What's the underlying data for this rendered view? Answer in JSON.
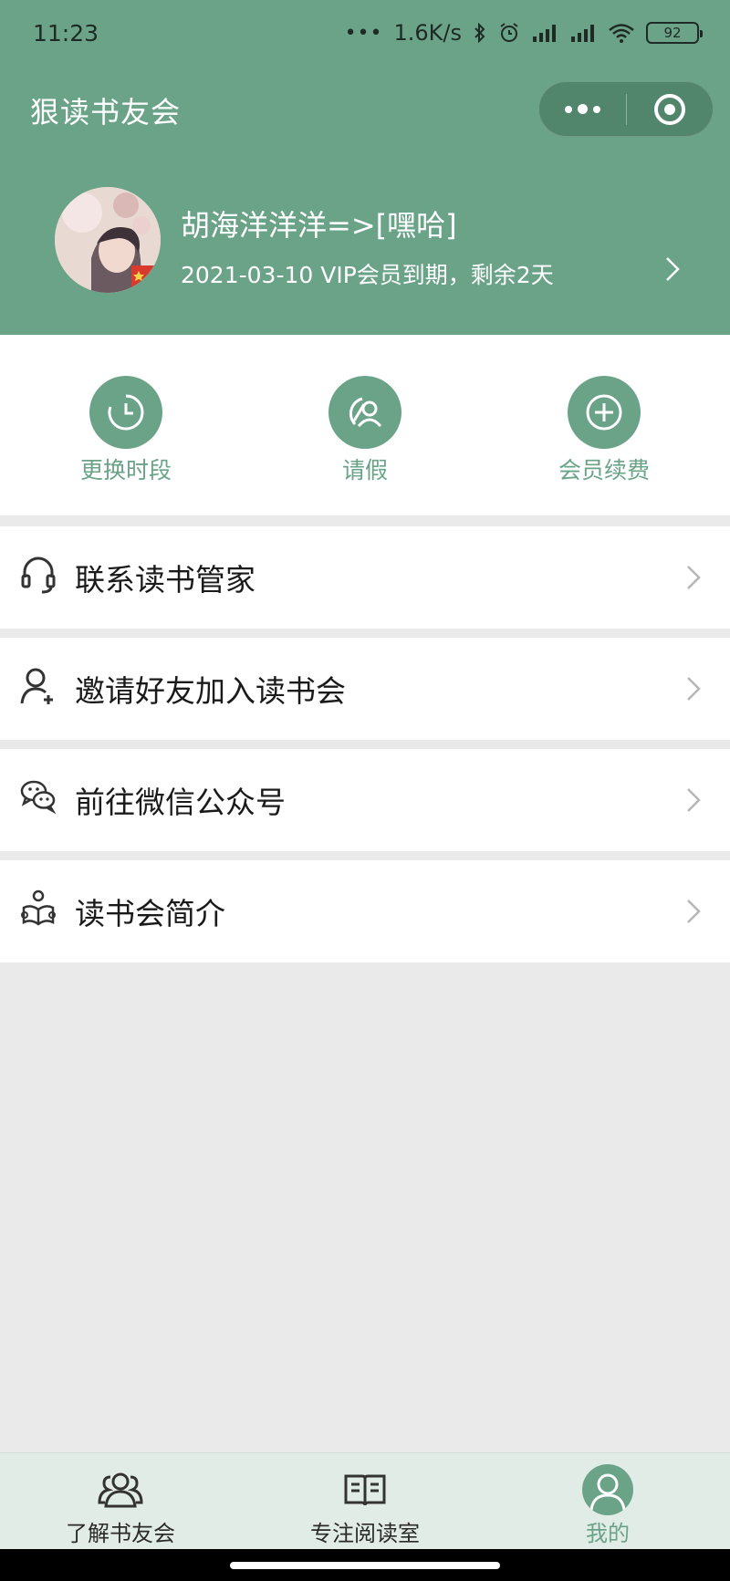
{
  "status_bar": {
    "time": "11:23",
    "network_speed": "1.6K/s",
    "battery": "92"
  },
  "header": {
    "app_title": "狠读书友会",
    "username": "胡海洋洋洋=>[嘿哈]",
    "vip_info": "2021-03-10 VIP会员到期，剩余2天"
  },
  "quick_actions": [
    {
      "label": "更换时段",
      "icon": "clock-icon"
    },
    {
      "label": "请假",
      "icon": "leave-person-icon"
    },
    {
      "label": "会员续费",
      "icon": "plus-circle-icon"
    }
  ],
  "menu": [
    {
      "label": "联系读书管家",
      "icon": "headset-icon"
    },
    {
      "label": "邀请好友加入读书会",
      "icon": "add-user-icon"
    },
    {
      "label": "前往微信公众号",
      "icon": "wechat-icon"
    },
    {
      "label": "读书会简介",
      "icon": "reader-icon"
    }
  ],
  "tabbar": {
    "tabs": [
      {
        "label": "了解书友会",
        "icon": "group-icon"
      },
      {
        "label": "专注阅读室",
        "icon": "open-book-icon"
      },
      {
        "label": "我的",
        "icon": "profile-icon",
        "active": true
      }
    ]
  },
  "colors": {
    "brand_green": "#6aa388",
    "tabbar_bg": "#e2ece7",
    "page_bg": "#eaeaea"
  }
}
